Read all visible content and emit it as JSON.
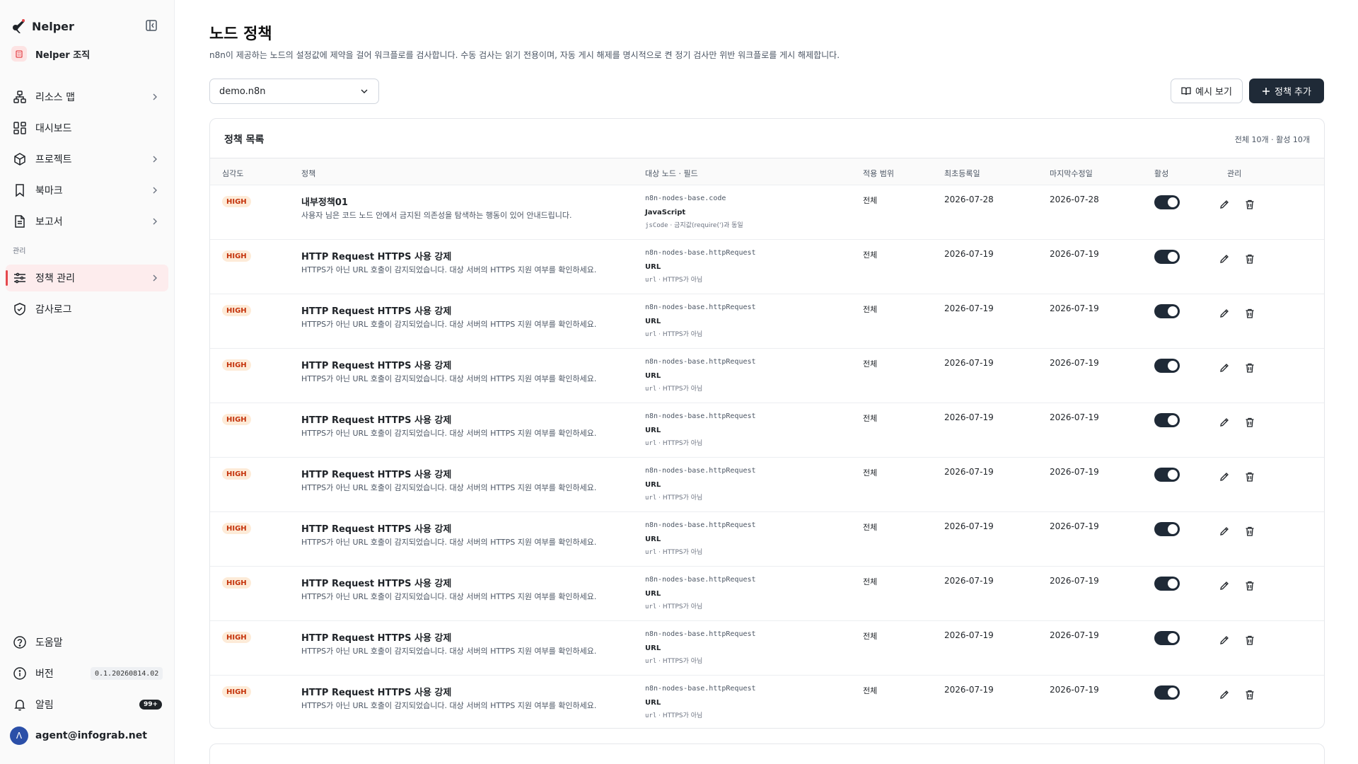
{
  "brand": {
    "name": "Nelper"
  },
  "org": {
    "name": "Nelper 조직"
  },
  "nav": {
    "resource_map": "리소스 맵",
    "dashboard": "대시보드",
    "project": "프로젝트",
    "bookmark": "북마크",
    "report": "보고서",
    "section_admin": "관리",
    "policy": "정책 관리",
    "audit": "감사로그"
  },
  "footer": {
    "help": "도움말",
    "version_label": "버전",
    "version_value": "0.1.20260814.02",
    "alerts_label": "알림",
    "alerts_count": "99+",
    "user": "agent@infograb.net",
    "user_initial": "Λ"
  },
  "page": {
    "title": "노드 정책",
    "description": "n8n이 제공하는 노드의 설정값에 제약을 걸어 워크플로를 검사합니다. 수동 검사는 읽기 전용이며, 자동 게시 해제를 명시적으로 켠 정기 검사만 위반 워크플로를 게시 해제합니다.",
    "instance_select": "demo.n8n",
    "example_button": "예시 보기",
    "add_button": "정책 추가"
  },
  "list": {
    "title": "정책 목록",
    "count": "전체 10개 · 활성 10개",
    "columns": {
      "severity": "심각도",
      "policy": "정책",
      "target": "대상 노드 · 필드",
      "scope": "적용 범위",
      "created": "최초등록일",
      "updated": "마지막수정일",
      "active": "활성",
      "manage": "관리"
    },
    "rows": [
      {
        "severity": "HIGH",
        "name": "내부정책01",
        "desc": "사용자 님은 코드 노드 안에서 금지된 의존성을 탐색하는 행동이 있어 안내드립니다.",
        "node": "n8n-nodes-base.code",
        "label": "JavaScript",
        "field": "jsCode",
        "cond": "금지값(require(')과 동일",
        "scope": "전체",
        "created": "2026-07-28",
        "updated": "2026-07-28",
        "active": true
      },
      {
        "severity": "HIGH",
        "name": "HTTP Request HTTPS 사용 강제",
        "desc": "HTTPS가 아닌 URL 호출이 감지되었습니다. 대상 서버의 HTTPS 지원 여부를 확인하세요.",
        "node": "n8n-nodes-base.httpRequest",
        "label": "URL",
        "field": "url",
        "cond": "HTTPS가 아님",
        "scope": "전체",
        "created": "2026-07-19",
        "updated": "2026-07-19",
        "active": true
      },
      {
        "severity": "HIGH",
        "name": "HTTP Request HTTPS 사용 강제",
        "desc": "HTTPS가 아닌 URL 호출이 감지되었습니다. 대상 서버의 HTTPS 지원 여부를 확인하세요.",
        "node": "n8n-nodes-base.httpRequest",
        "label": "URL",
        "field": "url",
        "cond": "HTTPS가 아님",
        "scope": "전체",
        "created": "2026-07-19",
        "updated": "2026-07-19",
        "active": true
      },
      {
        "severity": "HIGH",
        "name": "HTTP Request HTTPS 사용 강제",
        "desc": "HTTPS가 아닌 URL 호출이 감지되었습니다. 대상 서버의 HTTPS 지원 여부를 확인하세요.",
        "node": "n8n-nodes-base.httpRequest",
        "label": "URL",
        "field": "url",
        "cond": "HTTPS가 아님",
        "scope": "전체",
        "created": "2026-07-19",
        "updated": "2026-07-19",
        "active": true
      },
      {
        "severity": "HIGH",
        "name": "HTTP Request HTTPS 사용 강제",
        "desc": "HTTPS가 아닌 URL 호출이 감지되었습니다. 대상 서버의 HTTPS 지원 여부를 확인하세요.",
        "node": "n8n-nodes-base.httpRequest",
        "label": "URL",
        "field": "url",
        "cond": "HTTPS가 아님",
        "scope": "전체",
        "created": "2026-07-19",
        "updated": "2026-07-19",
        "active": true
      },
      {
        "severity": "HIGH",
        "name": "HTTP Request HTTPS 사용 강제",
        "desc": "HTTPS가 아닌 URL 호출이 감지되었습니다. 대상 서버의 HTTPS 지원 여부를 확인하세요.",
        "node": "n8n-nodes-base.httpRequest",
        "label": "URL",
        "field": "url",
        "cond": "HTTPS가 아님",
        "scope": "전체",
        "created": "2026-07-19",
        "updated": "2026-07-19",
        "active": true
      },
      {
        "severity": "HIGH",
        "name": "HTTP Request HTTPS 사용 강제",
        "desc": "HTTPS가 아닌 URL 호출이 감지되었습니다. 대상 서버의 HTTPS 지원 여부를 확인하세요.",
        "node": "n8n-nodes-base.httpRequest",
        "label": "URL",
        "field": "url",
        "cond": "HTTPS가 아님",
        "scope": "전체",
        "created": "2026-07-19",
        "updated": "2026-07-19",
        "active": true
      },
      {
        "severity": "HIGH",
        "name": "HTTP Request HTTPS 사용 강제",
        "desc": "HTTPS가 아닌 URL 호출이 감지되었습니다. 대상 서버의 HTTPS 지원 여부를 확인하세요.",
        "node": "n8n-nodes-base.httpRequest",
        "label": "URL",
        "field": "url",
        "cond": "HTTPS가 아님",
        "scope": "전체",
        "created": "2026-07-19",
        "updated": "2026-07-19",
        "active": true
      },
      {
        "severity": "HIGH",
        "name": "HTTP Request HTTPS 사용 강제",
        "desc": "HTTPS가 아닌 URL 호출이 감지되었습니다. 대상 서버의 HTTPS 지원 여부를 확인하세요.",
        "node": "n8n-nodes-base.httpRequest",
        "label": "URL",
        "field": "url",
        "cond": "HTTPS가 아님",
        "scope": "전체",
        "created": "2026-07-19",
        "updated": "2026-07-19",
        "active": true
      },
      {
        "severity": "HIGH",
        "name": "HTTP Request HTTPS 사용 강제",
        "desc": "HTTPS가 아닌 URL 호출이 감지되었습니다. 대상 서버의 HTTPS 지원 여부를 확인하세요.",
        "node": "n8n-nodes-base.httpRequest",
        "label": "URL",
        "field": "url",
        "cond": "HTTPS가 아님",
        "scope": "전체",
        "created": "2026-07-19",
        "updated": "2026-07-19",
        "active": true
      }
    ]
  },
  "colors": {
    "accent": "#e5484d",
    "dark_button": "#1f2a37",
    "badge_bg": "#fdebd8",
    "badge_text": "#c4320a"
  }
}
